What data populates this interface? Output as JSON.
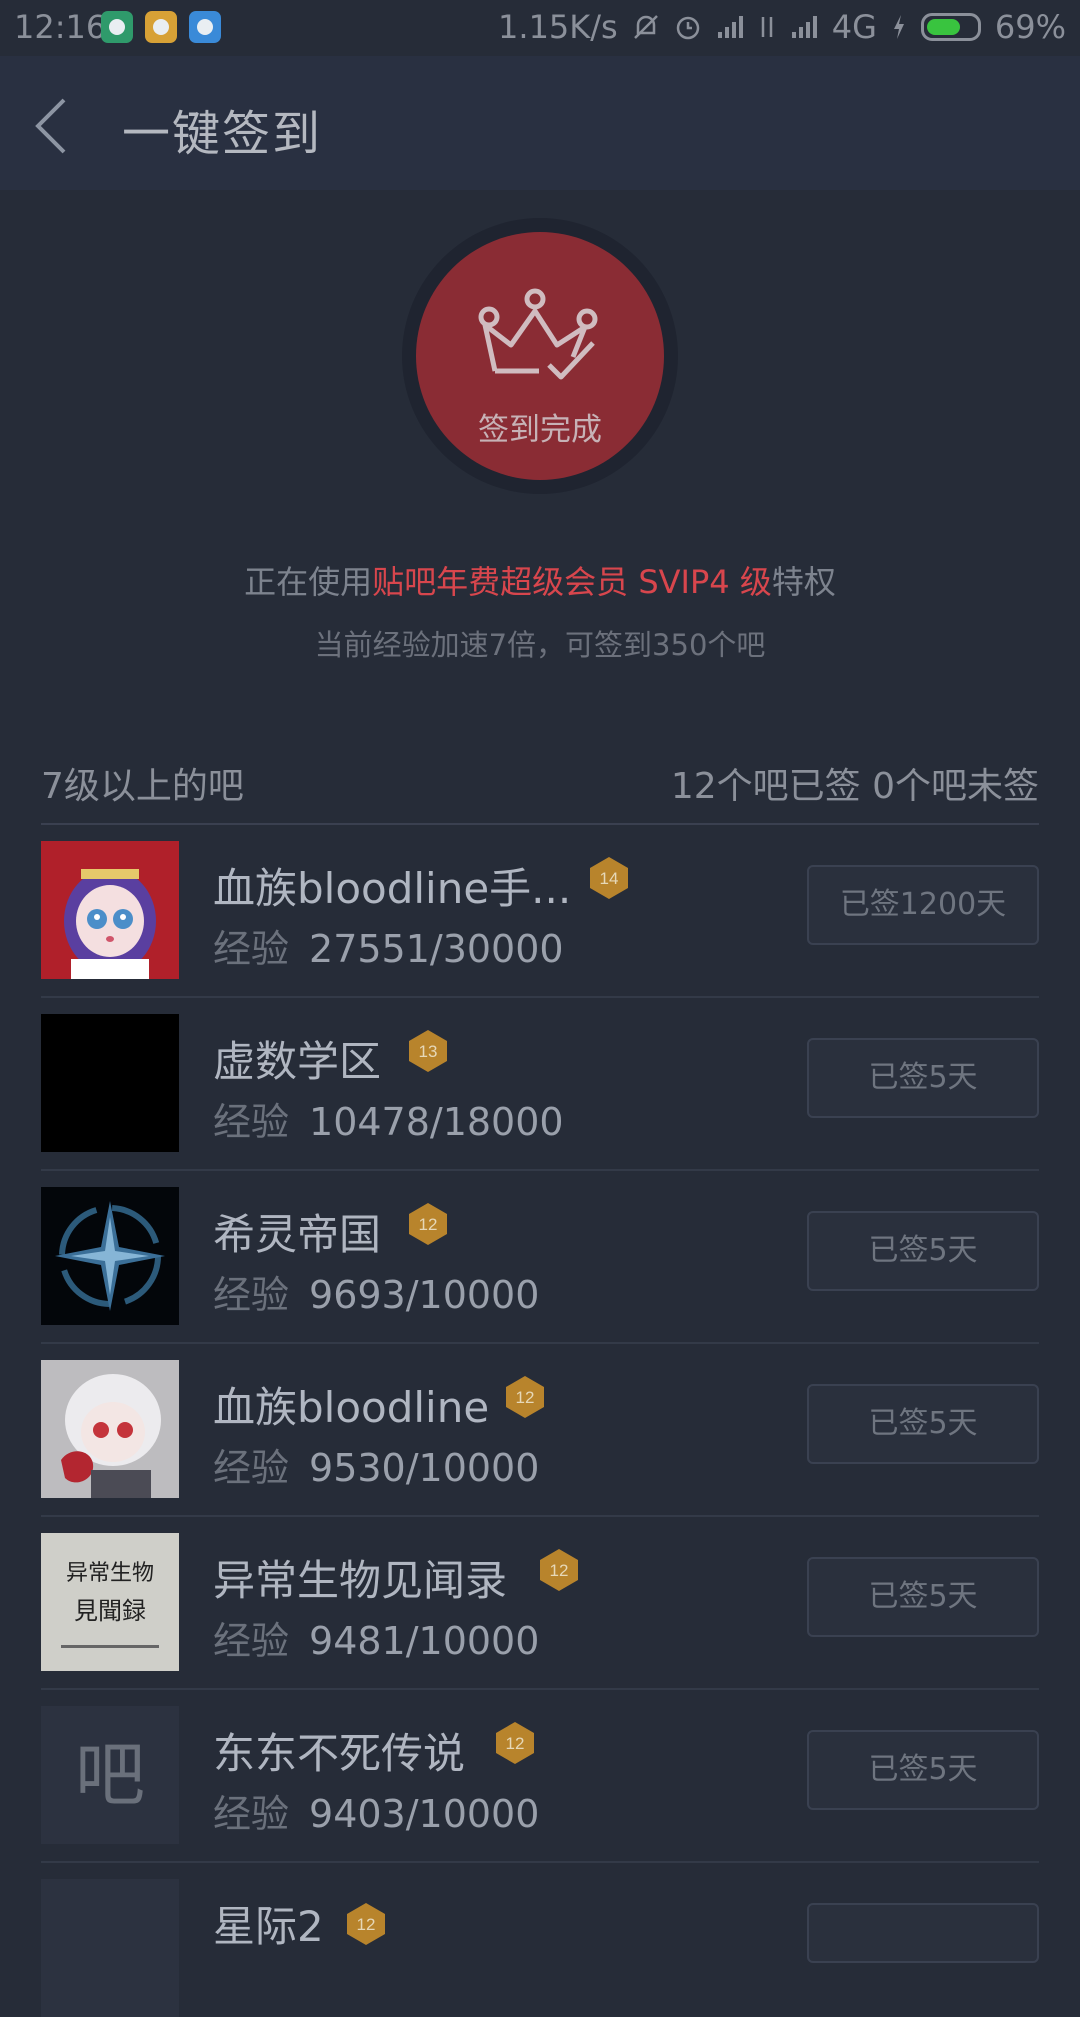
{
  "status_bar": {
    "time": "12:16",
    "net_speed": "1.15K/s",
    "network": "4G",
    "battery": "69%",
    "battery_fraction": 0.69
  },
  "header": {
    "title": "一键签到"
  },
  "sign": {
    "status": "签到完成",
    "vip_prefix": "正在使用",
    "vip_highlight": "贴吧年费超级会员 SVIP4 级",
    "vip_suffix": "特权",
    "speed_text": "当前经验加速7倍，可签到350个吧"
  },
  "section": {
    "left": "7级以上的吧",
    "right": "12个吧已签 0个吧未签"
  },
  "forums": [
    {
      "name": "血族bloodline手...",
      "level": "14",
      "exp_label": "经验",
      "exp": "27551/30000",
      "signed": "已签1200天",
      "avatar": "anime-girl-avatar"
    },
    {
      "name": "虚数学区",
      "level": "13",
      "exp_label": "经验",
      "exp": "10478/18000",
      "signed": "已签5天",
      "avatar": "black-avatar"
    },
    {
      "name": "希灵帝国",
      "level": "12",
      "exp_label": "经验",
      "exp": "9693/10000",
      "signed": "已签5天",
      "avatar": "emblem-avatar"
    },
    {
      "name": "血族bloodline",
      "level": "12",
      "exp_label": "经验",
      "exp": "9530/10000",
      "signed": "已签5天",
      "avatar": "white-hair-girl-avatar"
    },
    {
      "name": "异常生物见闻录",
      "level": "12",
      "exp_label": "经验",
      "exp": "9481/10000",
      "signed": "已签5天",
      "avatar": "book-cover-avatar",
      "avatar_text_1": "异常生物",
      "avatar_text_2": "見聞録"
    },
    {
      "name": "东东不死传说",
      "level": "12",
      "exp_label": "经验",
      "exp": "9403/10000",
      "signed": "已签5天",
      "avatar": "default-ba-avatar",
      "avatar_text_1": "吧"
    },
    {
      "name": "星际2",
      "level": "12",
      "avatar": "partial-avatar"
    }
  ],
  "colors": {
    "background": "#262c38",
    "header": "#293041",
    "circle": "#8a2c34",
    "highlight": "#d8464d",
    "badge": "#b8842c"
  }
}
